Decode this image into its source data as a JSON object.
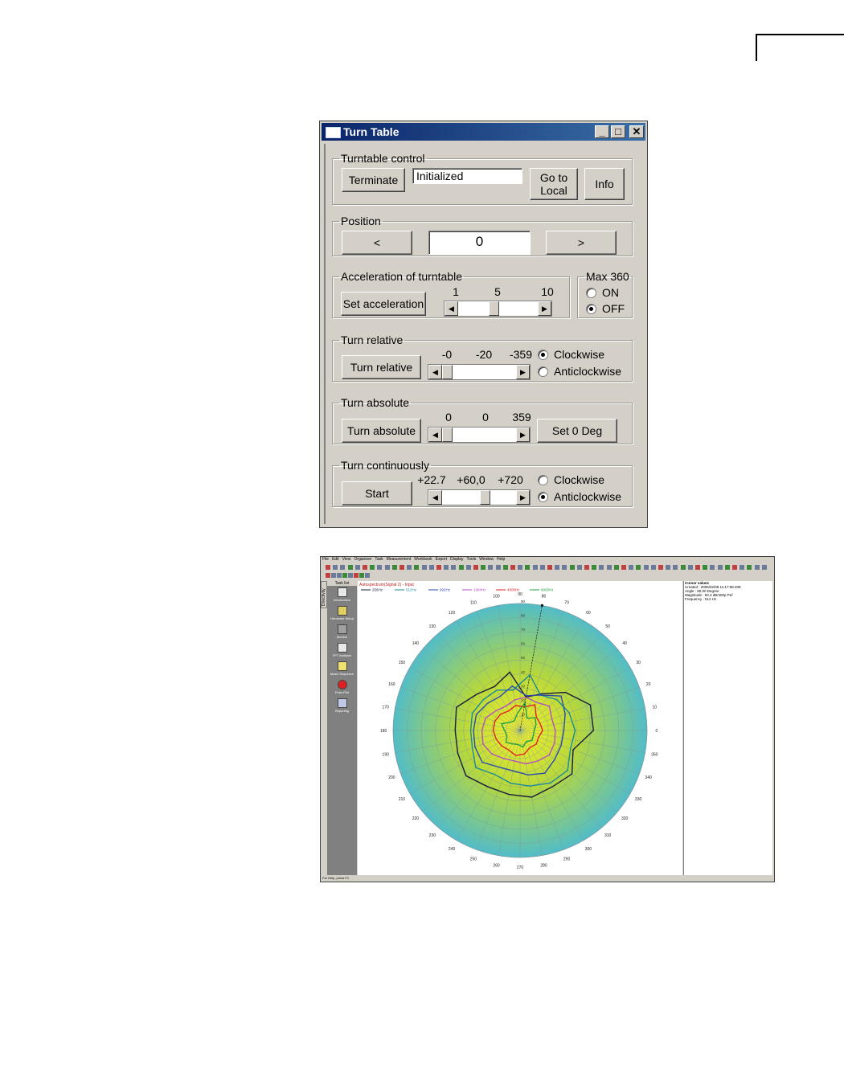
{
  "turntable": {
    "title": "Turn Table",
    "caption_buttons": {
      "minimize": "_",
      "maximize": "□",
      "close": "✕"
    },
    "control": {
      "legend": "Turntable control",
      "terminate_label": "Terminate",
      "status_value": "Initialized",
      "goto_local_label_1": "Go to",
      "goto_local_label_2": "Local",
      "info_label": "Info"
    },
    "position": {
      "legend": "Position",
      "left_label": "<",
      "value": "0",
      "right_label": ">"
    },
    "acceleration": {
      "legend": "Acceleration of turntable",
      "button_label": "Set acceleration",
      "ticks": [
        "1",
        "5",
        "10"
      ],
      "level": 5
    },
    "max360": {
      "legend": "Max 360",
      "options": [
        {
          "label": "ON",
          "selected": false
        },
        {
          "label": "OFF",
          "selected": true
        }
      ]
    },
    "turn_relative": {
      "legend": "Turn relative",
      "button_label": "Turn relative",
      "ticks": [
        "-0",
        "-20",
        "-359"
      ],
      "value": 0,
      "options": [
        {
          "label": "Clockwise",
          "selected": true
        },
        {
          "label": "Anticlockwise",
          "selected": false
        }
      ]
    },
    "turn_absolute": {
      "legend": "Turn absolute",
      "button_label": "Turn absolute",
      "ticks": [
        "0",
        "0",
        "359"
      ],
      "value": 0,
      "set_zero_label": "Set 0 Deg"
    },
    "turn_continuously": {
      "legend": "Turn continuously",
      "button_label": "Start",
      "ticks": [
        "+22.7",
        "+60,0",
        "+720"
      ],
      "value_fraction": 0.6,
      "options": [
        {
          "label": "Clockwise",
          "selected": false
        },
        {
          "label": "Anticlockwise",
          "selected": true
        }
      ]
    }
  },
  "app": {
    "menu": [
      "File",
      "Edit",
      "View",
      "Organizer",
      "Task",
      "Measurement",
      "Workbook",
      "Export",
      "Display",
      "Tools",
      "Window",
      "Help"
    ],
    "vertical_tab": "Directivity",
    "sidebar_title": "Task list",
    "sidebar_items": [
      "Introduction",
      "Hardware Setup",
      "Monitor",
      "FFT Analysis",
      "Music Sequence",
      "Polar Plot",
      "Reporting"
    ],
    "plot_title": "Autospectrum(Signal 2) - Input",
    "legend": [
      {
        "name": "256Hz",
        "color": "#1a1a3a"
      },
      {
        "name": "512Hz",
        "color": "#1a8a9a"
      },
      {
        "name": "992Hz",
        "color": "#2a4ab0"
      },
      {
        "name": "1984Hz",
        "color": "#b050c0"
      },
      {
        "name": "4000Hz",
        "color": "#e02020"
      },
      {
        "name": "8000Hz",
        "color": "#20a040"
      }
    ],
    "cursor_panel": {
      "title": "Cursor values",
      "created": "Created : 2005/02/08 11:17:58.408",
      "angle": "Angle : 80,00 Degree",
      "magnitude": "Magnitude : 50.3 dB/400p Pa²",
      "frequency": "Frequency : 512 Hz"
    },
    "statusbar": "For Help, press F1",
    "chart_data": {
      "type": "polar",
      "angle_ticks": [
        "0",
        "10",
        "20",
        "30",
        "40",
        "50",
        "60",
        "70",
        "80",
        "90",
        "100",
        "110",
        "120",
        "130",
        "140",
        "150",
        "160",
        "170",
        "180",
        "190",
        "200",
        "210",
        "220",
        "230",
        "240",
        "250",
        "260",
        "270",
        "280",
        "290",
        "300",
        "310",
        "320",
        "330",
        "340",
        "350"
      ],
      "radial_ticks": [
        "10",
        "20",
        "30",
        "40",
        "50",
        "60",
        "70",
        "80",
        "90"
      ],
      "radial_range": [
        0,
        90
      ],
      "cursor_angle": 80,
      "series": [
        {
          "name": "256Hz",
          "color": "#1a1a3a",
          "points": [
            [
              0,
              52
            ],
            [
              20,
              53
            ],
            [
              40,
              42
            ],
            [
              60,
              30
            ],
            [
              80,
              24
            ],
            [
              100,
              42
            ],
            [
              120,
              36
            ],
            [
              140,
              40
            ],
            [
              160,
              48
            ],
            [
              180,
              46
            ],
            [
              200,
              47
            ],
            [
              220,
              50
            ],
            [
              240,
              46
            ],
            [
              260,
              46
            ],
            [
              280,
              48
            ],
            [
              300,
              46
            ],
            [
              320,
              48
            ],
            [
              340,
              40
            ]
          ]
        },
        {
          "name": "512Hz",
          "color": "#1a8a9a",
          "points": [
            [
              0,
              39
            ],
            [
              20,
              37
            ],
            [
              40,
              34
            ],
            [
              60,
              29
            ],
            [
              80,
              40
            ],
            [
              100,
              29
            ],
            [
              120,
              33
            ],
            [
              140,
              34
            ],
            [
              160,
              36
            ],
            [
              180,
              35
            ],
            [
              200,
              36
            ],
            [
              220,
              41
            ],
            [
              240,
              36
            ],
            [
              260,
              38
            ],
            [
              280,
              40
            ],
            [
              300,
              43
            ],
            [
              320,
              44
            ],
            [
              340,
              38
            ]
          ]
        },
        {
          "name": "992Hz",
          "color": "#2a4ab0",
          "points": [
            [
              0,
              31
            ],
            [
              20,
              34
            ],
            [
              40,
              38
            ],
            [
              60,
              29
            ],
            [
              80,
              25
            ],
            [
              100,
              32
            ],
            [
              120,
              28
            ],
            [
              140,
              30
            ],
            [
              160,
              33
            ],
            [
              180,
              33
            ],
            [
              200,
              34
            ],
            [
              220,
              35
            ],
            [
              240,
              30
            ],
            [
              260,
              29
            ],
            [
              280,
              32
            ],
            [
              300,
              35
            ],
            [
              320,
              32
            ],
            [
              340,
              31
            ]
          ]
        },
        {
          "name": "1984Hz",
          "color": "#b050c0",
          "points": [
            [
              0,
              25
            ],
            [
              20,
              24
            ],
            [
              40,
              27
            ],
            [
              60,
              23
            ],
            [
              80,
              24
            ],
            [
              100,
              22
            ],
            [
              120,
              20
            ],
            [
              140,
              22
            ],
            [
              160,
              26
            ],
            [
              180,
              27
            ],
            [
              200,
              28
            ],
            [
              220,
              26
            ],
            [
              240,
              23
            ],
            [
              260,
              22
            ],
            [
              280,
              24
            ],
            [
              300,
              25
            ],
            [
              320,
              27
            ],
            [
              340,
              26
            ]
          ]
        },
        {
          "name": "4000Hz",
          "color": "#e02020",
          "points": [
            [
              0,
              16
            ],
            [
              20,
              15
            ],
            [
              40,
              15
            ],
            [
              60,
              21
            ],
            [
              80,
              17
            ],
            [
              100,
              18
            ],
            [
              120,
              16
            ],
            [
              140,
              18
            ],
            [
              160,
              19
            ],
            [
              180,
              19
            ],
            [
              200,
              18
            ],
            [
              220,
              17
            ],
            [
              240,
              16
            ],
            [
              260,
              18
            ],
            [
              280,
              17
            ],
            [
              300,
              14
            ],
            [
              320,
              15
            ],
            [
              340,
              14
            ]
          ]
        },
        {
          "name": "8000Hz",
          "color": "#20a040",
          "points": [
            [
              0,
              10
            ],
            [
              20,
              12
            ],
            [
              40,
              14
            ],
            [
              60,
              10
            ],
            [
              80,
              20
            ],
            [
              100,
              12
            ],
            [
              120,
              8
            ],
            [
              140,
              9
            ],
            [
              160,
              14
            ],
            [
              180,
              11
            ],
            [
              200,
              10
            ],
            [
              220,
              13
            ],
            [
              240,
              11
            ],
            [
              260,
              10
            ],
            [
              280,
              12
            ],
            [
              300,
              9
            ],
            [
              320,
              11
            ],
            [
              340,
              10
            ]
          ]
        }
      ]
    }
  }
}
